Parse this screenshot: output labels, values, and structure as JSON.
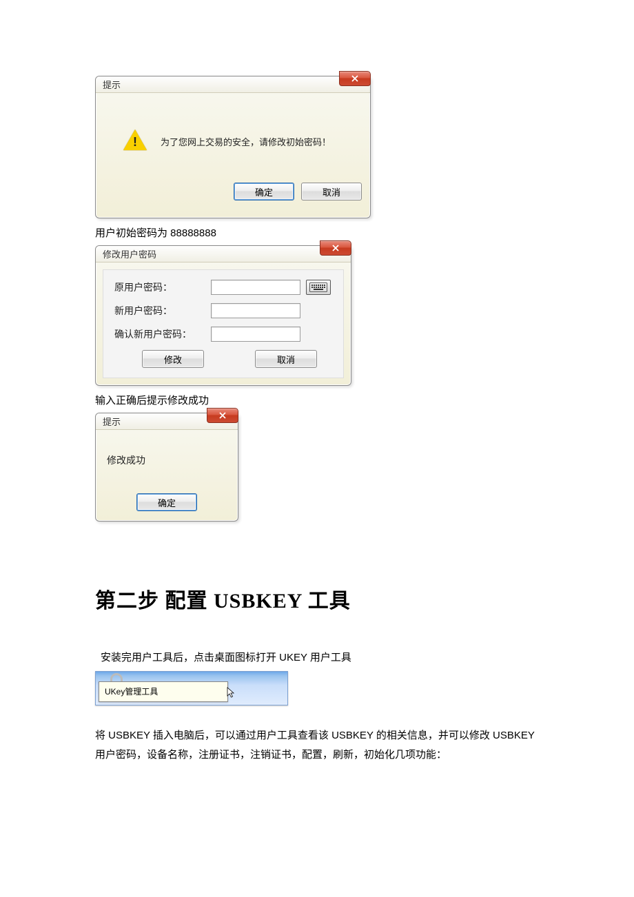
{
  "dialog1": {
    "title": "提示",
    "message": "为了您网上交易的安全，请修改初始密码！",
    "ok": "确定",
    "cancel": "取消"
  },
  "caption1": "用户初始密码为 88888888",
  "dialog2": {
    "title": "修改用户密码",
    "label_old": "原用户密码：",
    "label_new": "新用户密码：",
    "label_confirm": "确认新用户密码：",
    "btn_modify": "修改",
    "btn_cancel": "取消"
  },
  "caption2": "输入正确后提示修改成功",
  "dialog3": {
    "title": "提示",
    "message": "修改成功",
    "ok": "确定"
  },
  "heading": "第二步  配置 USBKEY 工具",
  "para1": "安装完用户工具后，点击桌面图标打开 UKEY 用户工具",
  "tooltip_label": "UKey管理工具",
  "para2": "将 USBKEY 插入电脑后，可以通过用户工具查看该 USBKEY 的相关信息，并可以修改 USBKEY 用户密码，设备名称，注册证书，注销证书，配置，刷新，初始化几项功能："
}
